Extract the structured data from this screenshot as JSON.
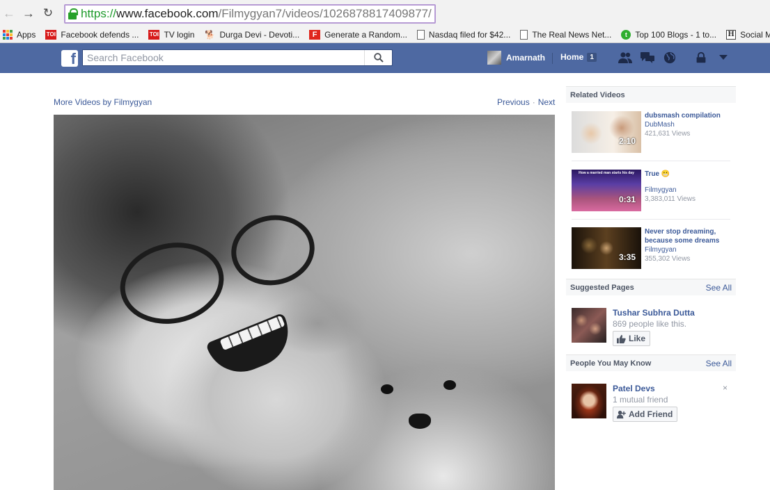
{
  "browser": {
    "url": {
      "scheme": "https://",
      "host": "www.facebook.com",
      "path": "/Filmygyan7/videos/1026878817409877/"
    },
    "bookmarks": [
      {
        "label": "Apps",
        "icon": "apps-grid-icon"
      },
      {
        "label": "Facebook defends ...",
        "icon": "toi-icon"
      },
      {
        "label": "TV login",
        "icon": "toi-icon"
      },
      {
        "label": "Durga Devi - Devoti...",
        "icon": "dog-icon"
      },
      {
        "label": "Generate a Random...",
        "icon": "f-logo-icon"
      },
      {
        "label": "Nasdaq filed for $42...",
        "icon": "document-icon"
      },
      {
        "label": "The Real News Net...",
        "icon": "document-icon"
      },
      {
        "label": "Top 100 Blogs - 1 to...",
        "icon": "green-logo-icon"
      },
      {
        "label": "Social M",
        "icon": "h-logo-icon"
      }
    ],
    "colors": {
      "https": "#1d9a2a",
      "url_box_border": "#b69ad4"
    }
  },
  "fb_header": {
    "logo": "f",
    "search_placeholder": "Search Facebook",
    "user_name": "Amarnath",
    "home_label": "Home",
    "home_count": "1",
    "bar_color": "#4e69a2"
  },
  "main": {
    "more_videos": "More Videos by Filmygyan",
    "previous": "Previous",
    "separator": "·",
    "next": "Next"
  },
  "related_videos": {
    "header": "Related Videos",
    "items": [
      {
        "title": "dubsmash compilation",
        "owner": "DubMash",
        "views": "421,631 Views",
        "duration": "2:10"
      },
      {
        "title": "True 😬",
        "owner": "Filmygyan",
        "views": "3,383,011 Views",
        "duration": "0:31",
        "thumb_caption": "How a married man starts his day"
      },
      {
        "title": "Never stop dreaming, because some dreams",
        "owner": "Filmygyan",
        "views": "355,302 Views",
        "duration": "3:35"
      }
    ]
  },
  "suggested_pages": {
    "header": "Suggested Pages",
    "see_all": "See All",
    "page": {
      "name": "Tushar Subhra Dutta",
      "likes": "869 people like this.",
      "button": "Like"
    }
  },
  "people_you_may_know": {
    "header": "People You May Know",
    "see_all": "See All",
    "person": {
      "name": "Patel Devs",
      "mutual": "1 mutual friend",
      "button": "Add Friend",
      "close": "×"
    }
  }
}
